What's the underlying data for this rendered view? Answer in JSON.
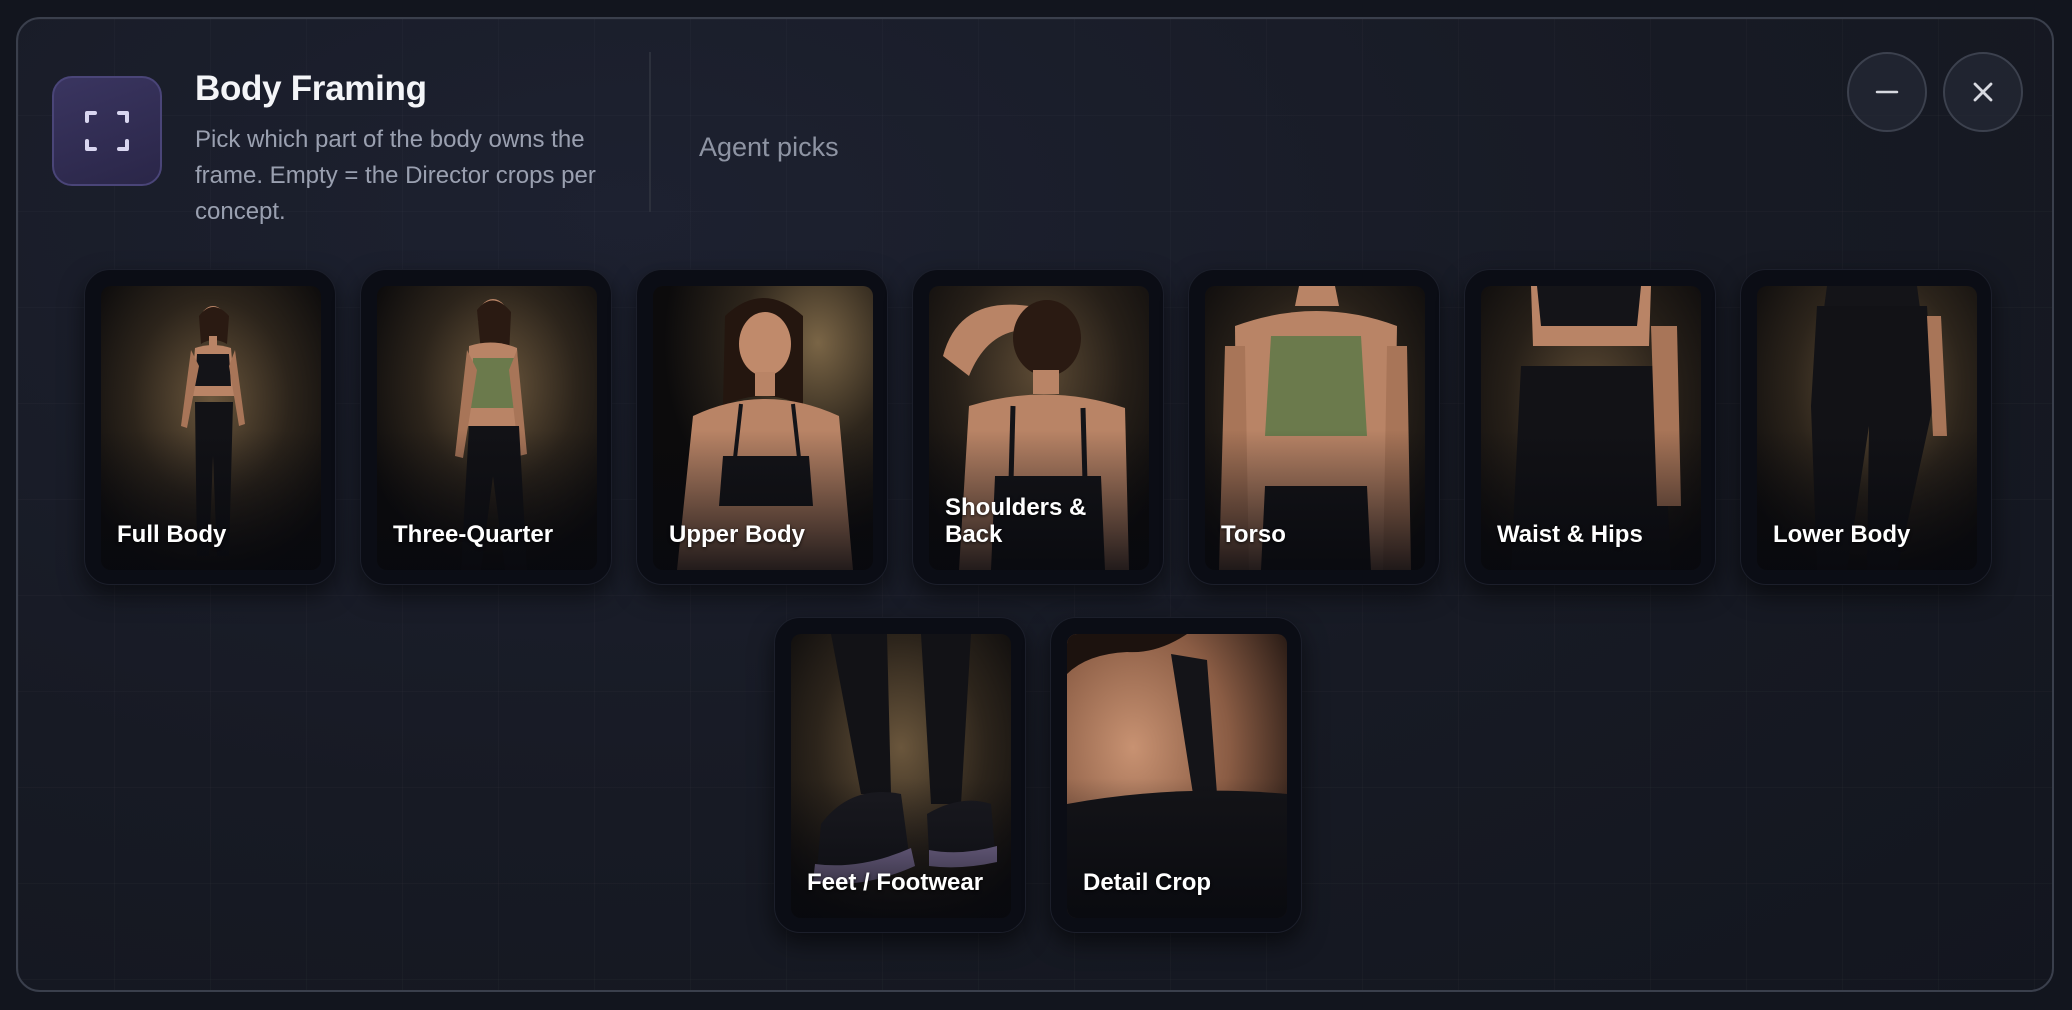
{
  "header": {
    "icon": "frame-corners-icon",
    "title": "Body Framing",
    "subtitle": "Pick which part of the body owns the frame. Empty = the Director crops per concept.",
    "agent_label": "Agent picks"
  },
  "controls": {
    "minimize_icon": "minus-icon",
    "close_icon": "close-icon"
  },
  "options": [
    {
      "label": "Full Body"
    },
    {
      "label": "Three-Quarter"
    },
    {
      "label": "Upper Body"
    },
    {
      "label": "Shoulders & Back"
    },
    {
      "label": "Torso"
    },
    {
      "label": "Waist & Hips"
    },
    {
      "label": "Lower Body"
    },
    {
      "label": "Feet / Footwear"
    },
    {
      "label": "Detail Crop"
    }
  ],
  "colors": {
    "accent": "#3a3560",
    "card": "#0b0d15",
    "top_olive": "#6b7a4c",
    "top_black": "#141418",
    "skin": "#b98466",
    "shoe_lilac": "#9a88b8"
  }
}
